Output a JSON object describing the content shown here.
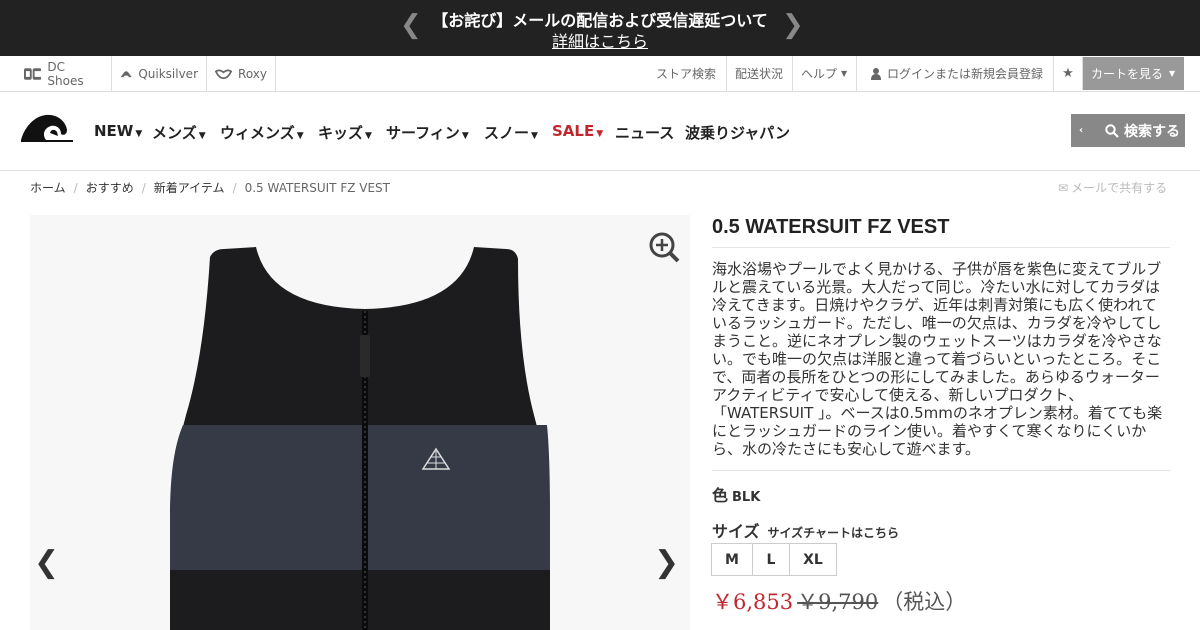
{
  "announcement": {
    "title": "【お詫び】メールの配信および受信遅延ついて",
    "link": "詳細はこちら"
  },
  "brands": [
    {
      "label": "DC Shoes",
      "icon": "dc-logo-icon"
    },
    {
      "label": "Quiksilver",
      "icon": "quiksilver-logo-icon"
    },
    {
      "label": "Roxy",
      "icon": "roxy-logo-icon"
    }
  ],
  "util_links": {
    "store": "ストア検索",
    "shipping": "配送状況",
    "help": "ヘルプ",
    "login": "ログインまたは新規会員登録",
    "cart": "カートを見る"
  },
  "nav": {
    "new": "NEW",
    "mens": "メンズ",
    "womens": "ウィメンズ",
    "kids": "キッズ",
    "surfing": "サーフィン",
    "snow": "スノー",
    "sale": "SALE",
    "news": "ニュース",
    "japan": "波乗りジャパン",
    "search": "検索する"
  },
  "colors": {
    "sale": "#c1272d",
    "topbar": "#222222",
    "button": "#888888"
  },
  "breadcrumb": {
    "home": "ホーム",
    "recommend": "おすすめ",
    "new_items": "新着アイテム",
    "current": "0.5 WATERSUIT FZ VEST"
  },
  "share": "メールで共有する",
  "product": {
    "title": "0.5 WATERSUIT FZ VEST",
    "description": "海水浴場やプールでよく見かける、子供が唇を紫色に変えてブルブルと震えている光景。大人だって同じ。冷たい水に対してカラダは冷えてきます。日焼けやクラゲ、近年は刺青対策にも広く使われているラッシュガード。ただし、唯一の欠点は、カラダを冷やしてしまうこと。逆にネオプレン製のウェットスーツはカラダを冷やさない。でも唯一の欠点は洋服と違って着づらいといったところ。そこで、両者の長所をひとつの形にしてみました。あらゆるウォーターアクティビティで安心して使える、新しいプロダクト、「WATERSUIT 」。ベースは0.5mmのネオプレン素材。着てても楽にとラッシュガードのライン使い。着やすくて寒くなりにくいから、水の冷たさにも安心して遊べます。",
    "color_label": "色",
    "color_value": "BLK",
    "size_label": "サイズ",
    "size_chart": "サイズチャートはこちら",
    "sizes": [
      "M",
      "L",
      "XL"
    ],
    "sale_price": "￥6,853",
    "original_price": "￥9,790",
    "tax_note": "（税込）"
  }
}
